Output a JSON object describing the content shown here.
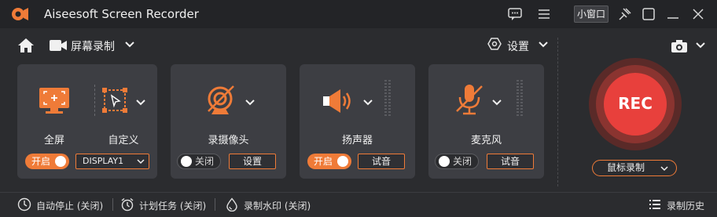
{
  "app": {
    "title": "Aiseesoft Screen Recorder"
  },
  "titlebar": {
    "mini_window_label": "小窗口"
  },
  "nav": {
    "mode_label": "屏幕录制",
    "settings_label": "设置"
  },
  "cards": {
    "display": {
      "fullscreen_label": "全屏",
      "custom_label": "自定义",
      "toggle_label": "开启",
      "toggle_state": "on",
      "display_select_value": "DISPLAY1"
    },
    "webcam": {
      "label": "录摄像头",
      "toggle_label": "关闭",
      "toggle_state": "off",
      "button_label": "设置"
    },
    "speaker": {
      "label": "扬声器",
      "toggle_label": "开启",
      "toggle_state": "on",
      "button_label": "试音"
    },
    "microphone": {
      "label": "麦克风",
      "toggle_label": "关闭",
      "toggle_state": "off",
      "button_label": "试音"
    }
  },
  "rec": {
    "label": "REC",
    "mouse_record_label": "鼠标录制"
  },
  "footer": {
    "auto_stop": "自动停止 (关闭)",
    "scheduled_task": "计划任务 (关闭)",
    "watermark": "录制水印 (关闭)",
    "history": "录制历史"
  },
  "colors": {
    "accent": "#ef7b38",
    "rec_red": "#e8403c",
    "background": "#2b2c2f",
    "card": "#3d3e43"
  }
}
